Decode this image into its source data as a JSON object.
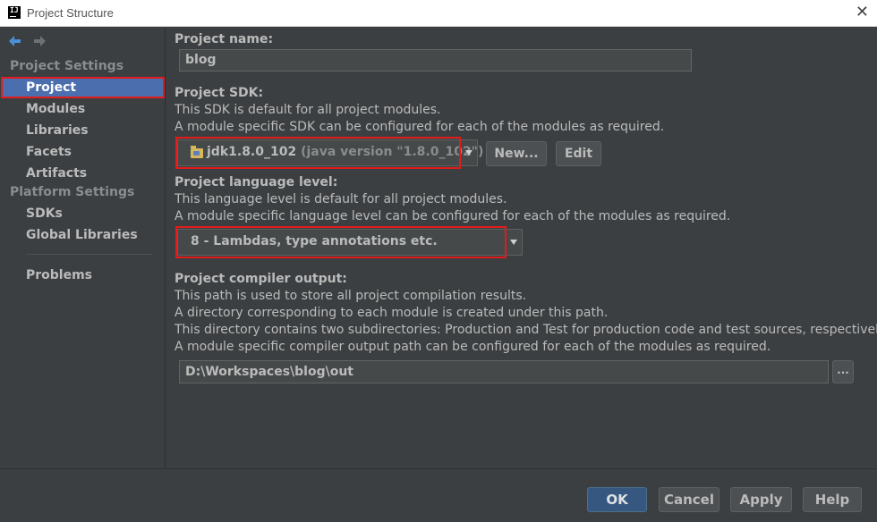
{
  "window": {
    "title": "Project Structure",
    "app_icon_text": "IJ"
  },
  "sidebar": {
    "sections": [
      {
        "title": "Project Settings",
        "items": [
          "Project",
          "Modules",
          "Libraries",
          "Facets",
          "Artifacts"
        ]
      },
      {
        "title": "Platform Settings",
        "items": [
          "SDKs",
          "Global Libraries"
        ]
      }
    ],
    "bottom_item": "Problems",
    "selected": "Project"
  },
  "main": {
    "project_name": {
      "label": "Project name:",
      "value": "blog"
    },
    "sdk": {
      "label": "Project SDK:",
      "desc1": "This SDK is default for all project modules.",
      "desc2": "A module specific SDK can be configured for each of the modules as required.",
      "selected_name": "jdk1.8.0_102",
      "selected_detail": "(java version \"1.8.0_102\")",
      "new_button": "New...",
      "edit_button": "Edit"
    },
    "language_level": {
      "label": "Project language level:",
      "desc1": "This language level is default for all project modules.",
      "desc2": "A module specific language level can be configured for each of the modules as required.",
      "selected": "8 - Lambdas, type annotations etc."
    },
    "compiler_output": {
      "label": "Project compiler output:",
      "desc1": "This path is used to store all project compilation results.",
      "desc2": "A directory corresponding to each module is created under this path.",
      "desc3": "This directory contains two subdirectories: Production and Test for production code and test sources, respectively.",
      "desc4": "A module specific compiler output path can be configured for each of the modules as required.",
      "path": "D:\\Workspaces\\blog\\out",
      "browse_button": "..."
    }
  },
  "footer": {
    "ok": "OK",
    "cancel": "Cancel",
    "apply": "Apply",
    "help": "Help"
  },
  "colors": {
    "background": "#3c3f41",
    "selection": "#4b6eaf",
    "highlight_box": "#e21b1b",
    "primary_button": "#365880"
  }
}
